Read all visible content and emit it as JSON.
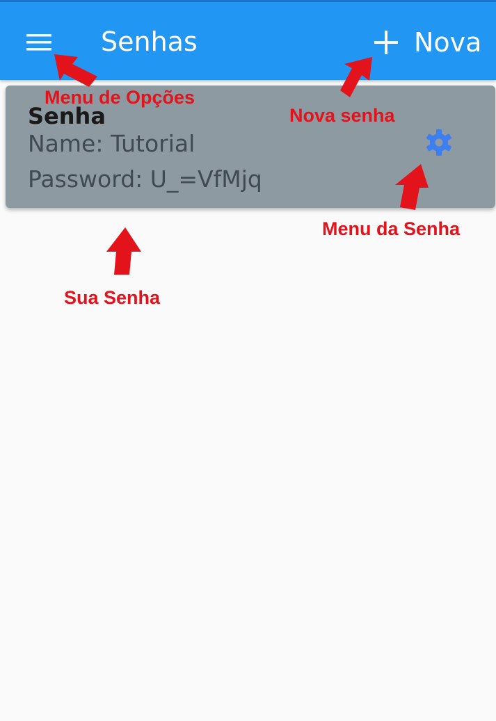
{
  "app_bar": {
    "title": "Senhas",
    "new_label": "Nova",
    "color": "#2196f3"
  },
  "password_card": {
    "title": "Senha",
    "name_line": "Name: Tutorial",
    "password_line": "Password: U_=VfMjq",
    "background": "#8e9aa1",
    "gear_color": "#3d7ff0"
  },
  "annotations": {
    "menu_options": "Menu de Opções",
    "new_password": "Nova senha",
    "password_menu": "Menu da Senha",
    "your_password": "Sua Senha",
    "color": "#e3131c"
  },
  "icons": {
    "menu": "hamburger-icon",
    "add": "plus-icon",
    "settings": "gear-icon"
  }
}
